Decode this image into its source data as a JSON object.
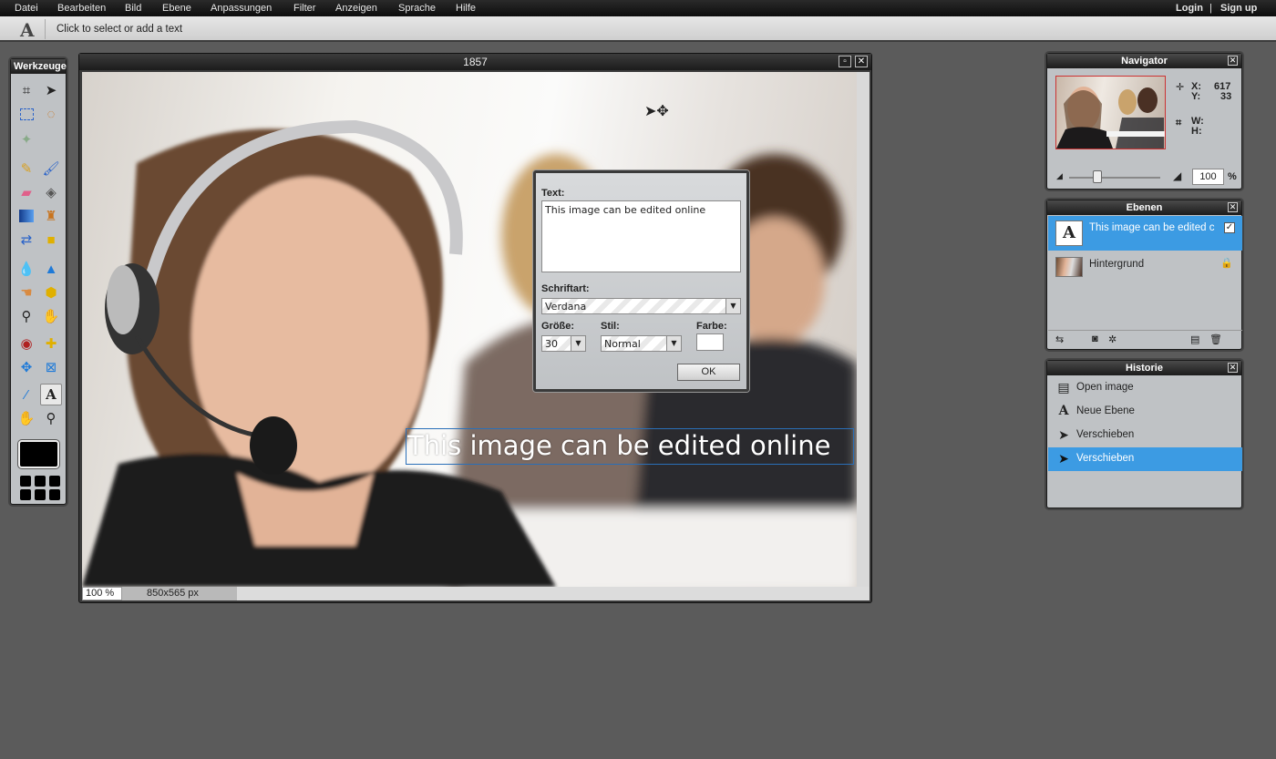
{
  "menu": {
    "items": [
      "Datei",
      "Bearbeiten",
      "Bild",
      "Ebene",
      "Anpassungen",
      "Filter",
      "Anzeigen",
      "Sprache",
      "Hilfe"
    ],
    "login": "Login",
    "divider": "|",
    "signup": "Sign up"
  },
  "tool_options": {
    "tool_icon": "A",
    "hint": "Click to select or add a text"
  },
  "tools_panel": {
    "title": "Werkzeuge",
    "tools": [
      "crop-icon",
      "move-icon",
      "marquee-icon",
      "lasso-icon",
      "magic-wand-icon",
      "pencil-icon",
      "brush-icon",
      "eraser-icon",
      "paint-bucket-icon",
      "gradient-icon",
      "clone-stamp-icon",
      "color-replace-icon",
      "shapes-icon",
      "blur-icon",
      "sharpen-icon",
      "smudge-icon",
      "sponge-icon",
      "dodge-icon",
      "burn-icon",
      "red-eye-icon",
      "spot-heal-icon",
      "bloat-icon",
      "pinch-icon",
      "color-picker-icon",
      "type-icon",
      "hand-icon",
      "zoom-icon"
    ],
    "selected_tool": "type-icon",
    "primary_color": "#000000"
  },
  "document": {
    "title": "1857",
    "overlay_text": "This image can be edited online",
    "zoom": "100 %",
    "size": "850x565 px"
  },
  "text_dialog": {
    "text_label": "Text:",
    "text_value": "This image can be edited online",
    "font_label": "Schriftart:",
    "font_value": "Verdana",
    "size_label": "Größe:",
    "size_value": "30",
    "style_label": "Stil:",
    "style_value": "Normal",
    "color_label": "Farbe:",
    "color_value": "#ffffff",
    "ok_label": "OK"
  },
  "navigator": {
    "title": "Navigator",
    "x_label": "X:",
    "x_value": "617",
    "y_label": "Y:",
    "y_value": "33",
    "w_label": "W:",
    "h_label": "H:",
    "zoom_value": "100",
    "zoom_unit": "%"
  },
  "layers": {
    "title": "Ebenen",
    "items": [
      {
        "name": "This image can be edited c",
        "selected": true,
        "visible": true
      },
      {
        "name": "Hintergrund",
        "selected": false,
        "locked": true
      }
    ]
  },
  "history": {
    "title": "Historie",
    "items": [
      {
        "label": "Open image",
        "icon": "open-image-icon"
      },
      {
        "label": "Neue Ebene",
        "icon": "type-icon"
      },
      {
        "label": "Verschieben",
        "icon": "move-icon"
      },
      {
        "label": "Verschieben",
        "icon": "move-icon",
        "selected": true
      }
    ]
  },
  "colors": {
    "selection_blue": "#3c9be3",
    "panel_bg": "#bfc2c5",
    "app_bg": "#5b5b5b"
  }
}
